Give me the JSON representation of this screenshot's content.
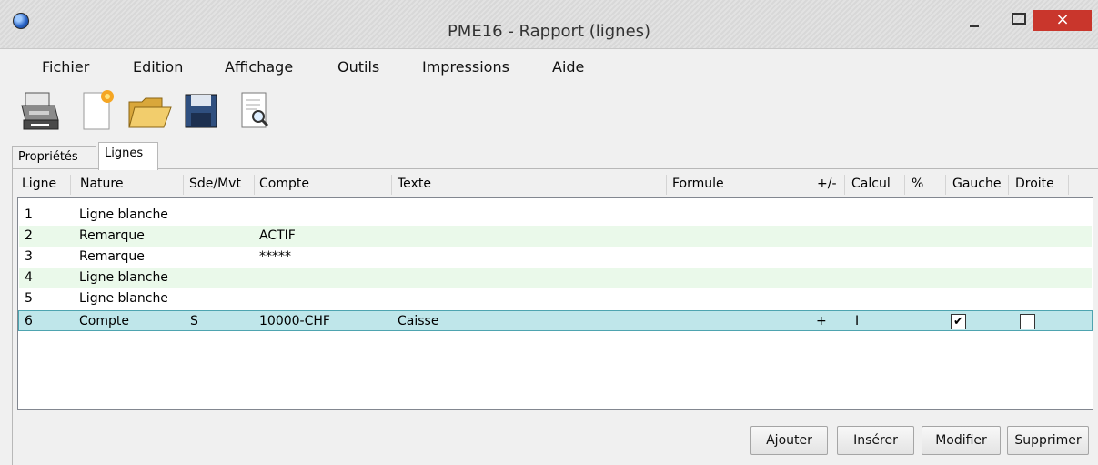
{
  "window": {
    "title": "PME16 - Rapport (lignes)",
    "close_glyph": "×"
  },
  "menu": [
    "Fichier",
    "Edition",
    "Affichage",
    "Outils",
    "Impressions",
    "Aide"
  ],
  "toolbar": [
    "printer-icon",
    "new-document-icon",
    "open-folder-icon",
    "save-floppy-icon",
    "print-preview-icon"
  ],
  "tabs": {
    "properties": "Propriétés",
    "lines": "Lignes"
  },
  "columns": {
    "ligne": "Ligne",
    "nature": "Nature",
    "sde_mvt": "Sde/Mvt",
    "compte": "Compte",
    "texte": "Texte",
    "formule": "Formule",
    "sign": "+/-",
    "calcul": "Calcul",
    "percent": "%",
    "gauche": "Gauche",
    "droite": "Droite"
  },
  "rows": [
    {
      "ligne": "1",
      "nature": "Ligne blanche",
      "sde_mvt": "",
      "compte": "",
      "texte": "",
      "sign": "",
      "calcul": ""
    },
    {
      "ligne": "2",
      "nature": "Remarque",
      "sde_mvt": "",
      "compte": "ACTIF",
      "texte": "",
      "sign": "",
      "calcul": ""
    },
    {
      "ligne": "3",
      "nature": "Remarque",
      "sde_mvt": "",
      "compte": "*****",
      "texte": "",
      "sign": "",
      "calcul": ""
    },
    {
      "ligne": "4",
      "nature": "Ligne blanche",
      "sde_mvt": "",
      "compte": "",
      "texte": "",
      "sign": "",
      "calcul": ""
    },
    {
      "ligne": "5",
      "nature": "Ligne blanche",
      "sde_mvt": "",
      "compte": "",
      "texte": "",
      "sign": "",
      "calcul": ""
    },
    {
      "ligne": "6",
      "nature": "Compte",
      "sde_mvt": "S",
      "compte": "10000-CHF",
      "texte": "Caisse",
      "sign": "+",
      "calcul": "I",
      "gauche_checked": true,
      "droite_checked": false,
      "check_glyph": "✔"
    }
  ],
  "buttons": {
    "add": "Ajouter",
    "insert": "Insérer",
    "modify": "Modifier",
    "delete": "Supprimer"
  },
  "colors": {
    "close": "#c9362c",
    "alt_row": "#eaf9ea",
    "selected_row": "#bfe6ea"
  }
}
